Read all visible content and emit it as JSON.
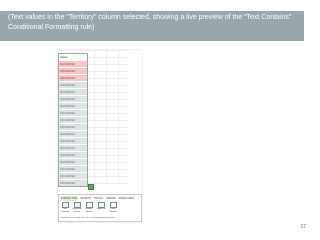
{
  "banner": {
    "text": "(Text values in the “Territory” column selected, showing a live preview of the “Text Contains” Conditional Formatting rule)"
  },
  "spreadsheet": {
    "header": "Sales",
    "rows": [
      {
        "value": "10/10/2012",
        "highlight": true
      },
      {
        "value": "10/10/2012",
        "highlight": true
      },
      {
        "value": "10/10/2012",
        "highlight": true
      },
      {
        "value": "10/10/2012",
        "highlight": false
      },
      {
        "value": "10/10/2012",
        "highlight": false
      },
      {
        "value": "10/10/2012",
        "highlight": false
      },
      {
        "value": "10/10/2012",
        "highlight": false
      },
      {
        "value": "10/10/2012",
        "highlight": false
      },
      {
        "value": "10/10/2012",
        "highlight": false
      },
      {
        "value": "10/10/2012",
        "highlight": false
      },
      {
        "value": "10/10/2012",
        "highlight": false
      },
      {
        "value": "10/10/2012",
        "highlight": false
      },
      {
        "value": "10/10/2012",
        "highlight": false
      },
      {
        "value": "10/10/2012",
        "highlight": false
      },
      {
        "value": "10/10/2012",
        "highlight": false
      },
      {
        "value": "10/10/2012",
        "highlight": false
      },
      {
        "value": "10/10/2012",
        "highlight": false
      },
      {
        "value": "10/10/2012",
        "highlight": false
      }
    ],
    "highlight_color": "#f4c8c8"
  },
  "quick_analysis": {
    "tabs": [
      {
        "label": "FORMATTING",
        "active": true
      },
      {
        "label": "CHARTS",
        "active": false
      },
      {
        "label": "TOTALS",
        "active": false
      },
      {
        "label": "TABLES",
        "active": false
      },
      {
        "label": "SPARKLINES",
        "active": false
      }
    ],
    "options": [
      {
        "label": "Text Contains",
        "icon": "text-contains-icon",
        "active": false
      },
      {
        "label": "Duplicate Values",
        "icon": "duplicate-values-icon",
        "active": true
      },
      {
        "label": "Unique Values",
        "icon": "unique-values-icon",
        "active": false
      },
      {
        "label": "Equal To",
        "icon": "equal-to-icon",
        "active": false
      },
      {
        "label": "Clear Format",
        "icon": "clear-format-icon",
        "active": false
      }
    ],
    "hint": "Conditional Formatting uses rules to highlight interesting data."
  },
  "page_number": "17"
}
